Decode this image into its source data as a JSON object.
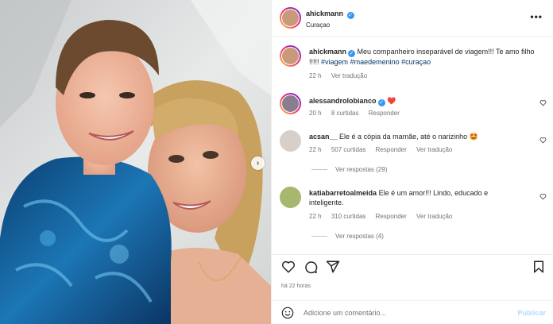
{
  "post": {
    "author": "ahickmann",
    "location": "Curaçao",
    "more_label": "•••"
  },
  "caption": {
    "author": "ahickmann",
    "text": "Meu companheiro inseparável de viagem!!! Te amo filho !!!!! ",
    "tags": [
      "#viagem",
      "#maedemenino",
      "#curaçao"
    ],
    "time": "22 h",
    "translate": "Ver tradução"
  },
  "comments": [
    {
      "author": "alessandrolobianco",
      "verified": true,
      "text": "❤️",
      "time": "20 h",
      "likes": "8 curtidas",
      "reply": "Responder"
    },
    {
      "author": "acsan__",
      "text": "Ele é a cópia da mamãe, até o narizinho 🤩",
      "time": "22 h",
      "likes": "507 curtidas",
      "reply": "Responder",
      "translate": "Ver tradução",
      "view_replies": "Ver respostas (29)"
    },
    {
      "author": "katiabarretoalmeida",
      "text": "Ele é um amor!!! Lindo, educado e inteligente.",
      "time": "22 h",
      "likes": "310 curtidas",
      "reply": "Responder",
      "translate": "Ver tradução",
      "view_replies": "Ver respostas (4)"
    }
  ],
  "footer": {
    "posted": "há 22 horas",
    "add_comment_placeholder": "Adicione um comentário...",
    "publish": "Publicar"
  },
  "colors": {
    "verified": "#3897f0",
    "hashtag": "#00376b",
    "muted": "#737373",
    "publish_disabled": "#b3dbff"
  },
  "icons": [
    "verified-icon",
    "more-icon",
    "heart-icon",
    "comment-icon",
    "share-icon",
    "save-icon",
    "emoji-icon",
    "chevron-right-icon"
  ]
}
